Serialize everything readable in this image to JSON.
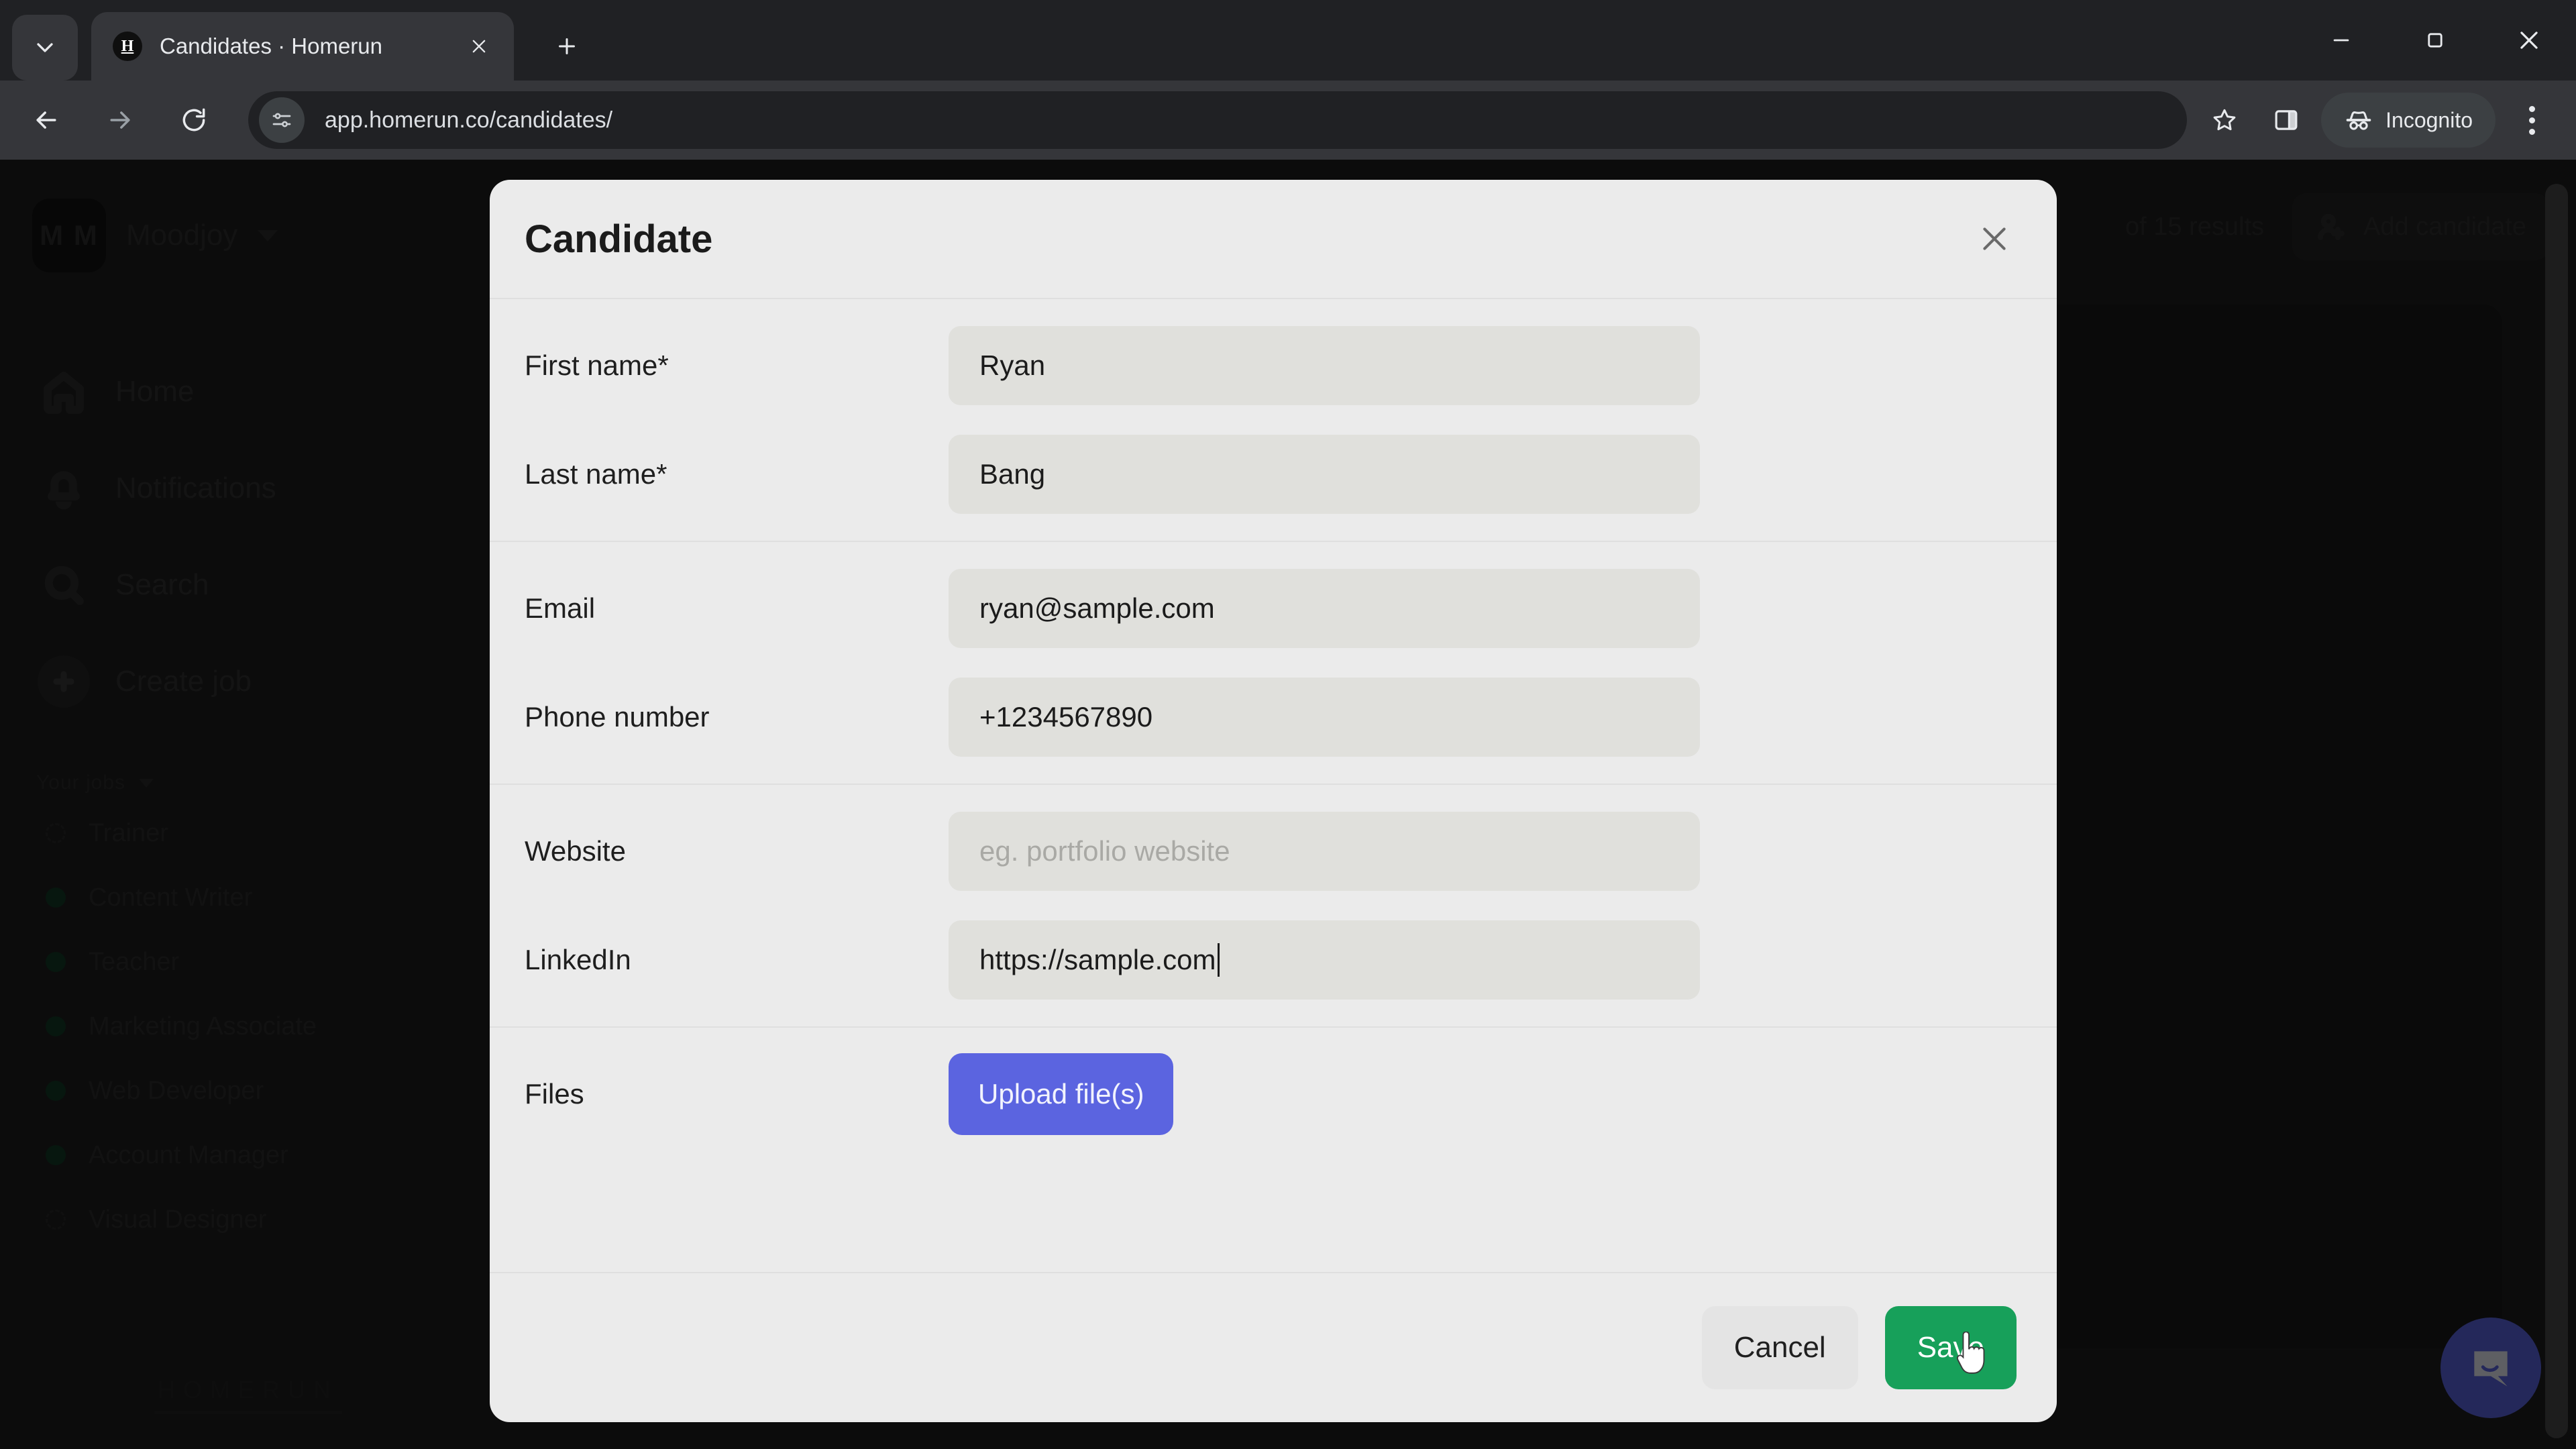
{
  "browser": {
    "tab": {
      "title": "Candidates · Homerun",
      "favicon_letter": "H"
    },
    "tab_list_icon": "chevron-down-icon",
    "new_tab_icon": "plus-icon",
    "tab_close_icon": "close-icon",
    "back_icon": "arrow-left-icon",
    "forward_icon": "arrow-right-icon",
    "reload_icon": "reload-icon",
    "url": "app.homerun.co/candidates/",
    "site_settings_icon": "tune-icon",
    "bookmark_icon": "star-icon",
    "side_panel_icon": "side-panel-icon",
    "incognito_label": "Incognito",
    "incognito_icon": "incognito-icon",
    "menu_icon": "kebab-menu-icon",
    "window_minimize_icon": "minimize-icon",
    "window_maximize_icon": "maximize-icon",
    "window_close_icon": "close-icon"
  },
  "sidebar": {
    "org": {
      "initials": "M M",
      "name": "Moodjoy",
      "caret_icon": "chevron-down-icon"
    },
    "nav": [
      {
        "label": "Home",
        "icon": "home-icon"
      },
      {
        "label": "Notifications",
        "icon": "bell-icon"
      },
      {
        "label": "Search",
        "icon": "search-icon"
      },
      {
        "label": "Create job",
        "icon": "plus-circle-icon"
      }
    ],
    "jobs_header": "Your jobs",
    "jobs": [
      {
        "label": "Trainer",
        "status": "draft"
      },
      {
        "label": "Content Writer",
        "status": "live"
      },
      {
        "label": "Teacher",
        "status": "live"
      },
      {
        "label": "Marketing Associate",
        "status": "live"
      },
      {
        "label": "Web Developer",
        "status": "live"
      },
      {
        "label": "Account Manager",
        "status": "live"
      },
      {
        "label": "Visual Designer",
        "status": "draft"
      }
    ],
    "brand": "HOMERUN"
  },
  "page": {
    "results_text": "of 15 results",
    "add_candidate_label": "Add candidate",
    "add_candidate_icon": "person-add-icon",
    "chat_icon": "chat-bubble-icon"
  },
  "modal": {
    "title": "Candidate",
    "close_icon": "close-icon",
    "groups": [
      {
        "fields": [
          {
            "label": "First name*",
            "value": "Ryan",
            "placeholder": "",
            "has_caret": false
          },
          {
            "label": "Last name*",
            "value": "Bang",
            "placeholder": "",
            "has_caret": false
          }
        ]
      },
      {
        "fields": [
          {
            "label": "Email",
            "value": "ryan@sample.com",
            "placeholder": "",
            "has_caret": false
          },
          {
            "label": "Phone number",
            "value": "+1234567890",
            "placeholder": "",
            "has_caret": false
          }
        ]
      },
      {
        "fields": [
          {
            "label": "Website",
            "value": "",
            "placeholder": "eg. portfolio website",
            "has_caret": false
          },
          {
            "label": "LinkedIn",
            "value": "https://sample.com",
            "placeholder": "",
            "has_caret": true
          }
        ]
      }
    ],
    "files_label": "Files",
    "upload_label": "Upload file(s)",
    "cancel_label": "Cancel",
    "save_label": "Save"
  },
  "colors": {
    "accent_indigo": "#5b64e0",
    "save_green": "#17a05a",
    "modal_bg": "#ebebeb",
    "input_bg": "#e0e0dc",
    "app_dark": "#1e1e1e"
  }
}
